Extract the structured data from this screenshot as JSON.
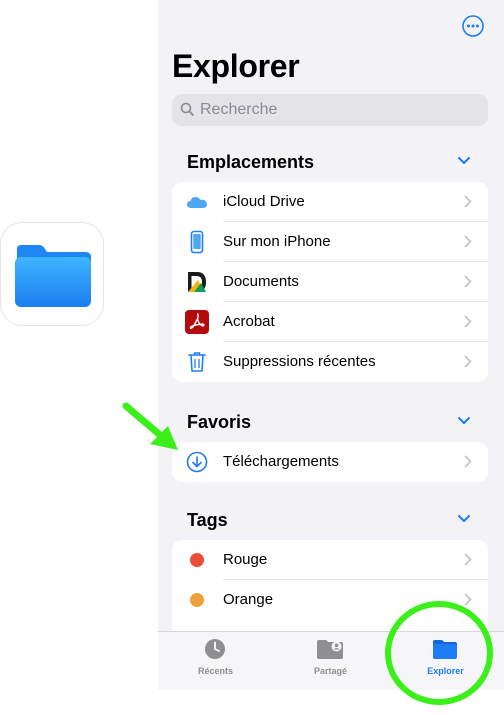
{
  "header": {
    "title": "Explorer",
    "more_icon": "ellipsis-circle-icon"
  },
  "search": {
    "placeholder": "Recherche"
  },
  "sections": {
    "locations": {
      "label": "Emplacements",
      "items": [
        {
          "label": "iCloud Drive",
          "icon": "icloud-icon"
        },
        {
          "label": "Sur mon iPhone",
          "icon": "iphone-icon"
        },
        {
          "label": "Documents",
          "icon": "documents-app-icon"
        },
        {
          "label": "Acrobat",
          "icon": "acrobat-icon"
        },
        {
          "label": "Suppressions récentes",
          "icon": "trash-icon"
        }
      ]
    },
    "favorites": {
      "label": "Favoris",
      "items": [
        {
          "label": "Téléchargements",
          "icon": "download-icon"
        }
      ]
    },
    "tags": {
      "label": "Tags",
      "items": [
        {
          "label": "Rouge",
          "color": "#ea4b3c"
        },
        {
          "label": "Orange",
          "color": "#f0a03a"
        }
      ]
    }
  },
  "tabbar": {
    "tabs": [
      {
        "label": "Récents",
        "icon": "clock-icon",
        "active": false
      },
      {
        "label": "Partagé",
        "icon": "shared-folder-icon",
        "active": false
      },
      {
        "label": "Explorer",
        "icon": "folder-icon",
        "active": true
      }
    ]
  },
  "colors": {
    "accent": "#1e7cf5",
    "annotation": "#3bf01a",
    "background": "#f2f2f7"
  }
}
